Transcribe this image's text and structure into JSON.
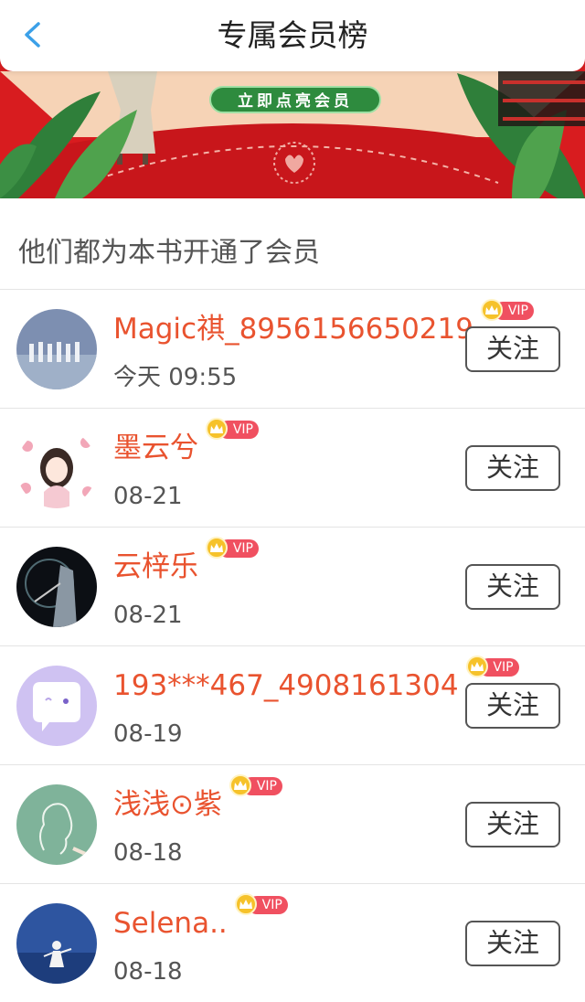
{
  "header": {
    "title": "专属会员榜",
    "back_icon": "chevron-left-icon"
  },
  "banner": {
    "button_label": "立即点亮会员"
  },
  "section": {
    "title": "他们都为本书开通了会员"
  },
  "members": [
    {
      "name": "Magic祺_8956156650219",
      "time": "今天 09:55",
      "badge": "VIP",
      "follow": "关注"
    },
    {
      "name": "墨云兮",
      "time": "08-21",
      "badge": "VIP",
      "follow": "关注"
    },
    {
      "name": "云梓乐",
      "time": "08-21",
      "badge": "VIP",
      "follow": "关注"
    },
    {
      "name": "193***467_4908161304",
      "time": "08-19",
      "badge": "VIP",
      "follow": "关注"
    },
    {
      "name": "浅浅⊙紫",
      "time": "08-18",
      "badge": "VIP",
      "follow": "关注"
    },
    {
      "name": "Selena..",
      "time": "08-18",
      "badge": "VIP",
      "follow": "关注"
    }
  ],
  "colors": {
    "accent_name": "#e9532f",
    "vip_badge": "#f05060",
    "banner_red": "#d81c1f",
    "banner_green": "#2e8b3e"
  }
}
